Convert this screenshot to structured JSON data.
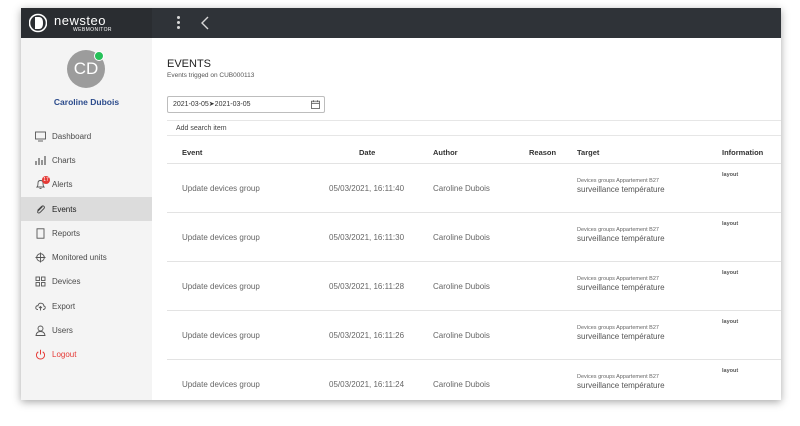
{
  "brand": {
    "name": "newsteo",
    "subtitle": "WEBMONITOR"
  },
  "user": {
    "initials": "CD",
    "name": "Caroline Dubois",
    "status_color": "#27c15a"
  },
  "nav": [
    {
      "label": "Dashboard",
      "icon": "monitor-icon"
    },
    {
      "label": "Charts",
      "icon": "bar-chart-icon"
    },
    {
      "label": "Alerts",
      "icon": "bell-icon",
      "badge": "17"
    },
    {
      "label": "Events",
      "icon": "paperclip-icon",
      "active": true
    },
    {
      "label": "Reports",
      "icon": "document-icon"
    },
    {
      "label": "Monitored units",
      "icon": "crosshair-icon"
    },
    {
      "label": "Devices",
      "icon": "grid-icon"
    },
    {
      "label": "Export",
      "icon": "cloud-upload-icon"
    },
    {
      "label": "Users",
      "icon": "user-icon"
    },
    {
      "label": "Logout",
      "icon": "power-icon"
    }
  ],
  "page": {
    "title": "EVENTS",
    "subtitle": "Events trigged on CUB000113",
    "date_range": "2021-03-05➤2021-03-05",
    "search_placeholder": "Add search item"
  },
  "table": {
    "columns": [
      "Event",
      "Date",
      "Author",
      "Reason",
      "Target",
      "Information"
    ],
    "rows": [
      {
        "event": "Update devices group",
        "date": "05/03/2021, 16:11:40",
        "author": "Caroline Dubois",
        "reason": "",
        "target_small": "Devices groups Appartement B27",
        "target_big": "surveillance température",
        "info": "layout"
      },
      {
        "event": "Update devices group",
        "date": "05/03/2021, 16:11:30",
        "author": "Caroline Dubois",
        "reason": "",
        "target_small": "Devices groups Appartement B27",
        "target_big": "surveillance température",
        "info": "layout"
      },
      {
        "event": "Update devices group",
        "date": "05/03/2021, 16:11:28",
        "author": "Caroline Dubois",
        "reason": "",
        "target_small": "Devices groups Appartement B27",
        "target_big": "surveillance température",
        "info": "layout"
      },
      {
        "event": "Update devices group",
        "date": "05/03/2021, 16:11:26",
        "author": "Caroline Dubois",
        "reason": "",
        "target_small": "Devices groups Appartement B27",
        "target_big": "surveillance température",
        "info": "layout"
      },
      {
        "event": "Update devices group",
        "date": "05/03/2021, 16:11:24",
        "author": "Caroline Dubois",
        "reason": "",
        "target_small": "Devices groups Appartement B27",
        "target_big": "surveillance température",
        "info": "layout"
      }
    ]
  },
  "colors": {
    "topbar": "#2f3338",
    "accent_name": "#2b4b8c",
    "logout": "#e53935",
    "badge": "#e53935"
  }
}
